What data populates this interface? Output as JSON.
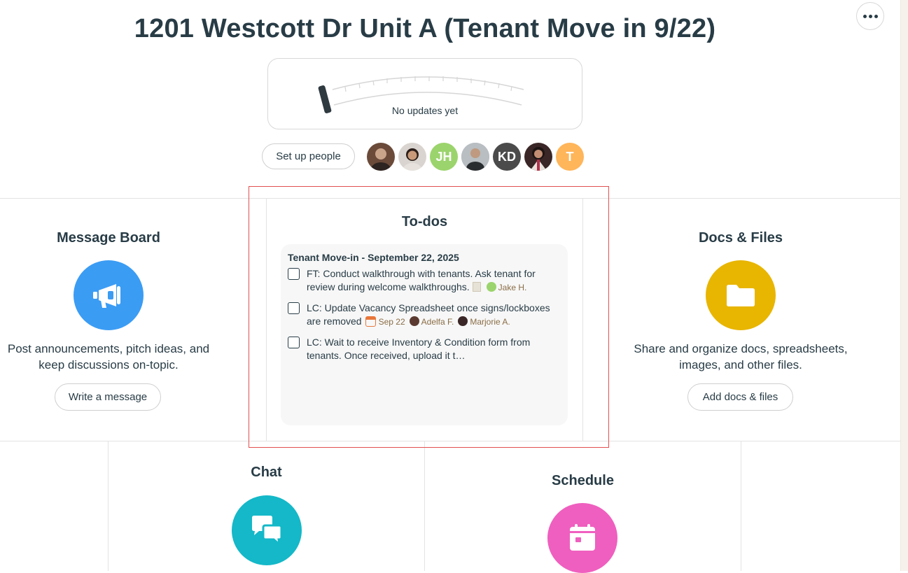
{
  "project": {
    "title": "1201 Westcott Dr Unit A (Tenant Move in 9/22)"
  },
  "hill_chart": {
    "status_text": "No updates yet"
  },
  "people": {
    "setup_label": "Set up people",
    "avatars": [
      {
        "kind": "photo",
        "color": "#6b4a3a"
      },
      {
        "kind": "photo",
        "color": "#7a5a4c"
      },
      {
        "kind": "initials",
        "initials": "JH",
        "color": "#9bd46c"
      },
      {
        "kind": "photo",
        "color": "#8a8f93"
      },
      {
        "kind": "initials",
        "initials": "KD",
        "color": "#4b4b4b"
      },
      {
        "kind": "photo",
        "color": "#5a3b3b"
      },
      {
        "kind": "initials",
        "initials": "T",
        "color": "#ffb55a"
      }
    ]
  },
  "tools": {
    "message_board": {
      "title": "Message Board",
      "description": "Post announcements, pitch ideas, and keep discussions on-topic.",
      "button": "Write a message",
      "color": "#3b9cf4",
      "icon": "megaphone-icon"
    },
    "todos": {
      "title": "To-dos",
      "list_title": "Tenant Move-in - September 22, 2025",
      "items": [
        {
          "text": "FT: Conduct walkthrough with tenants. Ask tenant for review during welcome walkthroughs.",
          "assignee": "Jake H.",
          "assignee_initials": "JH"
        },
        {
          "text": "LC: Update Vacancy Spreadsheet once signs/lockboxes are removed",
          "due": "Sep 22",
          "assignees": [
            "Adelfa F.",
            "Marjorie A."
          ]
        },
        {
          "text": "LC: Wait to receive Inventory & Condition form from tenants. Once received, upload it t…"
        }
      ]
    },
    "docs_files": {
      "title": "Docs & Files",
      "description": "Share and organize docs, spreadsheets, images, and other files.",
      "button": "Add docs & files",
      "color": "#e8b500",
      "icon": "folder-icon"
    },
    "chat": {
      "title": "Chat",
      "color": "#14b8c8",
      "icon": "chat-bubbles-icon"
    },
    "schedule": {
      "title": "Schedule",
      "color": "#ef5fbf",
      "icon": "calendar-icon"
    }
  }
}
